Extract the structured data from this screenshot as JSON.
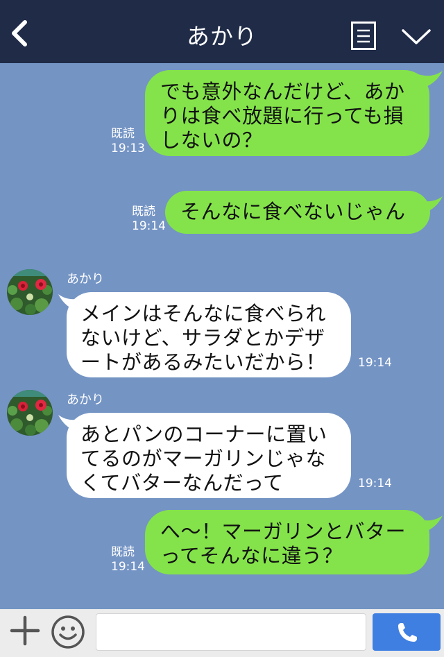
{
  "header": {
    "title": "あかり",
    "back_icon": "chevron-left-icon",
    "menu_icon": "memo-icon",
    "collapse_icon": "chevron-down-icon"
  },
  "messages": [
    {
      "side": "right",
      "lines": [
        "でも意外なんだけど、あか",
        "りは食べ放題に行っても損",
        "しないの？"
      ],
      "read": "既読",
      "time": "19:13"
    },
    {
      "side": "right",
      "lines": [
        "そんなに食べないじゃん"
      ],
      "read": "既読",
      "time": "19:14"
    },
    {
      "side": "left",
      "sender": "あかり",
      "lines": [
        "メインはそんなに食べられ",
        "ないけど、サラダとかデザ",
        "ートがあるみたいだから！"
      ],
      "time": "19:14"
    },
    {
      "side": "left",
      "sender": "あかり",
      "lines": [
        "あとパンのコーナーに置い",
        "てるのがマーガリンじゃな",
        "くてバターなんだって"
      ],
      "time": "19:14"
    },
    {
      "side": "right",
      "lines": [
        "へ～！マーガリンとバター",
        "ってそんなに違う？"
      ],
      "read": "既読",
      "time": "19:14"
    }
  ],
  "input_bar": {
    "plus_icon": "plus-icon",
    "emoji_icon": "smiley-icon",
    "message_placeholder": "",
    "call_icon": "phone-icon"
  },
  "colors": {
    "header_bg": "#1f2b47",
    "chat_bg": "#7494c4",
    "sent_bubble": "#84e34a",
    "received_bubble": "#ffffff",
    "call_button": "#3f7fe2"
  }
}
